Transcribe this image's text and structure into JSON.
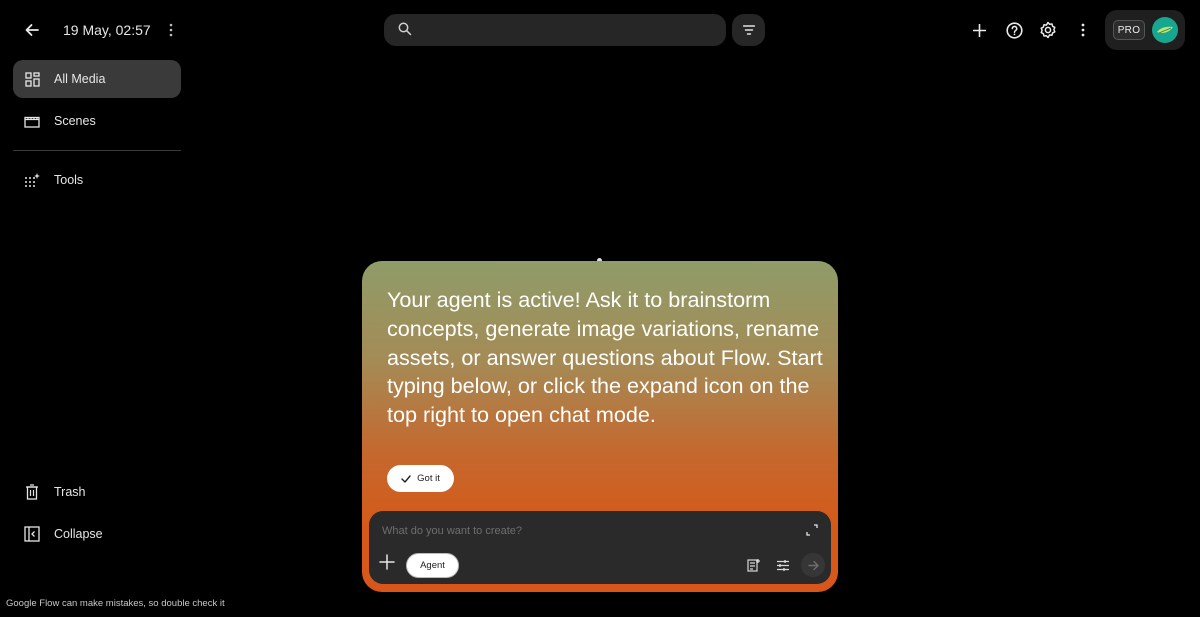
{
  "header": {
    "project_title": "19 May, 02:57",
    "search": {
      "placeholder": "",
      "value": ""
    },
    "pro_badge": "PRO"
  },
  "sidebar": {
    "items": [
      {
        "label": "All Media",
        "icon": "grid-icon",
        "active": true
      },
      {
        "label": "Scenes",
        "icon": "film-icon",
        "active": false
      },
      {
        "label": "Tools",
        "icon": "sparkle-grid-icon",
        "active": false
      },
      {
        "label": "Trash",
        "icon": "trash-icon",
        "active": false
      },
      {
        "label": "Collapse",
        "icon": "collapse-sidebar-icon",
        "active": false
      }
    ]
  },
  "agent_card": {
    "message": "Your agent is active! Ask it to brainstorm concepts, generate image variations, rename assets, or answer questions about Flow. Start typing below, or click the expand icon on the top right to open chat mode.",
    "got_it_label": "Got it"
  },
  "composer": {
    "placeholder": "What do you want to create?",
    "value": "",
    "mode_chip": "Agent"
  },
  "footer": {
    "disclaimer": "Google Flow can make mistakes, so double check it"
  },
  "colors": {
    "background": "#000000",
    "accent_orange": "#d9561b",
    "card_top": "#8f9c69",
    "avatar": "#17a68f"
  }
}
